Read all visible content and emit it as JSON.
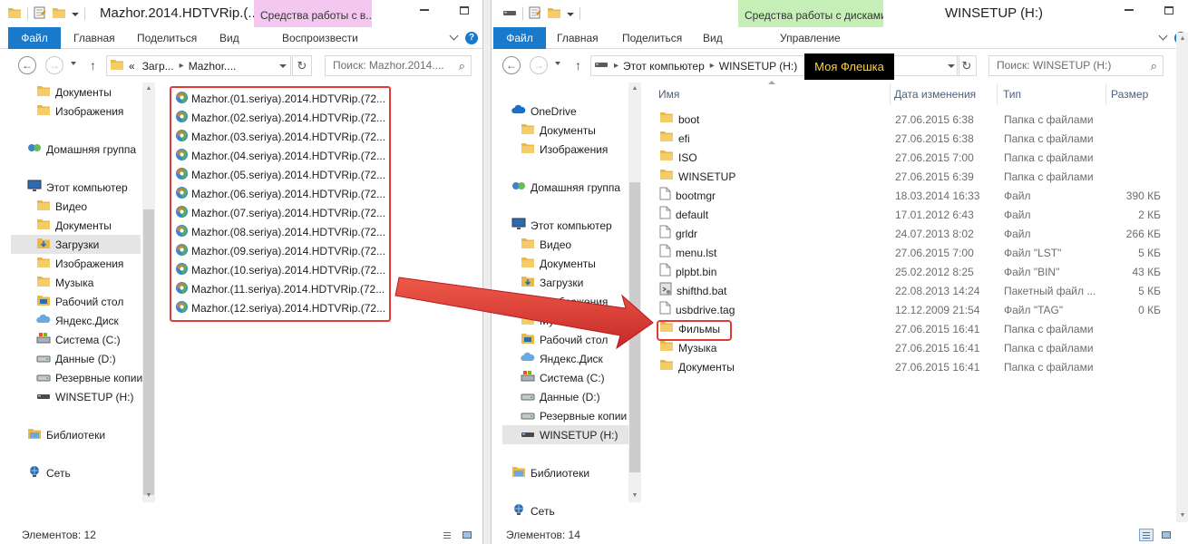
{
  "left": {
    "title": "Mazhor.2014.HDTVRip.(...",
    "tools_tab": "Средства работы с в...",
    "tools_color": "#f4c7f1",
    "ribbon": [
      "Файл",
      "Главная",
      "Поделиться",
      "Вид",
      "Воспроизвести"
    ],
    "address": {
      "overflow": "«",
      "segments": [
        "Загр...",
        "Mazhor...."
      ]
    },
    "search_placeholder": "Поиск: Mazhor.2014....",
    "nav": [
      {
        "label": "Документы",
        "icon": "documents-folder-icon"
      },
      {
        "label": "Изображения",
        "icon": "pictures-folder-icon"
      },
      {
        "label": "Домашняя группа",
        "icon": "homegroup-icon"
      },
      {
        "label": "Этот компьютер",
        "icon": "computer-icon"
      },
      {
        "label": "Видео",
        "icon": "videos-folder-icon"
      },
      {
        "label": "Документы",
        "icon": "documents-folder-icon"
      },
      {
        "label": "Загрузки",
        "icon": "downloads-folder-icon"
      },
      {
        "label": "Изображения",
        "icon": "pictures-folder-icon"
      },
      {
        "label": "Музыка",
        "icon": "music-folder-icon"
      },
      {
        "label": "Рабочий стол",
        "icon": "desktop-folder-icon"
      },
      {
        "label": "Яндекс.Диск",
        "icon": "yandex-disk-icon"
      },
      {
        "label": "Система (C:)",
        "icon": "system-drive-icon"
      },
      {
        "label": "Данные (D:)",
        "icon": "drive-icon"
      },
      {
        "label": "Резервные копии",
        "icon": "drive-icon"
      },
      {
        "label": "WINSETUP (H:)",
        "icon": "usb-drive-icon"
      },
      {
        "label": "Библиотеки",
        "icon": "libraries-icon"
      },
      {
        "label": "Сеть",
        "icon": "network-icon"
      }
    ],
    "files": [
      "Mazhor.(01.seriya).2014.HDTVRip.(72...",
      "Mazhor.(02.seriya).2014.HDTVRip.(72...",
      "Mazhor.(03.seriya).2014.HDTVRip.(72...",
      "Mazhor.(04.seriya).2014.HDTVRip.(72...",
      "Mazhor.(05.seriya).2014.HDTVRip.(72...",
      "Mazhor.(06.seriya).2014.HDTVRip.(72...",
      "Mazhor.(07.seriya).2014.HDTVRip.(72...",
      "Mazhor.(08.seriya).2014.HDTVRip.(72...",
      "Mazhor.(09.seriya).2014.HDTVRip.(72...",
      "Mazhor.(10.seriya).2014.HDTVRip.(72...",
      "Mazhor.(11.seriya).2014.HDTVRip.(72...",
      "Mazhor.(12.seriya).2014.HDTVRip.(72..."
    ],
    "status": "Элементов: 12"
  },
  "right": {
    "title": "WINSETUP (H:)",
    "tools_tab": "Средства работы с дисками",
    "tools_color": "#c6efb8",
    "ribbon": [
      "Файл",
      "Главная",
      "Поделиться",
      "Вид",
      "Управление"
    ],
    "address": {
      "segments": [
        "Этот компьютер",
        "WINSETUP (H:)"
      ]
    },
    "tooltip": "Моя Флешка",
    "search_placeholder": "Поиск: WINSETUP (H:)",
    "nav": [
      {
        "label": "OneDrive",
        "icon": "onedrive-icon"
      },
      {
        "label": "Документы",
        "icon": "documents-folder-icon"
      },
      {
        "label": "Изображения",
        "icon": "pictures-folder-icon"
      },
      {
        "label": "Домашняя группа",
        "icon": "homegroup-icon"
      },
      {
        "label": "Этот компьютер",
        "icon": "computer-icon"
      },
      {
        "label": "Видео",
        "icon": "videos-folder-icon"
      },
      {
        "label": "Документы",
        "icon": "documents-folder-icon"
      },
      {
        "label": "Загрузки",
        "icon": "downloads-folder-icon"
      },
      {
        "label": "Изображения",
        "icon": "pictures-folder-icon"
      },
      {
        "label": "Музыка",
        "icon": "music-folder-icon"
      },
      {
        "label": "Рабочий стол",
        "icon": "desktop-folder-icon"
      },
      {
        "label": "Яндекс.Диск",
        "icon": "yandex-disk-icon"
      },
      {
        "label": "Система (C:)",
        "icon": "system-drive-icon"
      },
      {
        "label": "Данные (D:)",
        "icon": "drive-icon"
      },
      {
        "label": "Резервные копии",
        "icon": "drive-icon"
      },
      {
        "label": "WINSETUP (H:)",
        "icon": "usb-drive-icon"
      },
      {
        "label": "Библиотеки",
        "icon": "libraries-icon"
      },
      {
        "label": "Сеть",
        "icon": "network-icon"
      }
    ],
    "columns": [
      "Имя",
      "Дата изменения",
      "Тип",
      "Размер"
    ],
    "rows": [
      {
        "name": "boot",
        "date": "27.06.2015 6:38",
        "type": "Папка с файлами",
        "size": "",
        "icon": "folder-icon"
      },
      {
        "name": "efi",
        "date": "27.06.2015 6:38",
        "type": "Папка с файлами",
        "size": "",
        "icon": "folder-icon"
      },
      {
        "name": "ISO",
        "date": "27.06.2015 7:00",
        "type": "Папка с файлами",
        "size": "",
        "icon": "folder-icon"
      },
      {
        "name": "WINSETUP",
        "date": "27.06.2015 6:39",
        "type": "Папка с файлами",
        "size": "",
        "icon": "folder-icon"
      },
      {
        "name": "bootmgr",
        "date": "18.03.2014 16:33",
        "type": "Файл",
        "size": "390 КБ",
        "icon": "file-icon"
      },
      {
        "name": "default",
        "date": "17.01.2012 6:43",
        "type": "Файл",
        "size": "2 КБ",
        "icon": "file-icon"
      },
      {
        "name": "grldr",
        "date": "24.07.2013 8:02",
        "type": "Файл",
        "size": "266 КБ",
        "icon": "file-icon"
      },
      {
        "name": "menu.lst",
        "date": "27.06.2015 7:00",
        "type": "Файл \"LST\"",
        "size": "5 КБ",
        "icon": "file-icon"
      },
      {
        "name": "plpbt.bin",
        "date": "25.02.2012 8:25",
        "type": "Файл \"BIN\"",
        "size": "43 КБ",
        "icon": "file-icon"
      },
      {
        "name": "shifthd.bat",
        "date": "22.08.2013 14:24",
        "type": "Пакетный файл ...",
        "size": "5 КБ",
        "icon": "batch-file-icon"
      },
      {
        "name": "usbdrive.tag",
        "date": "12.12.2009 21:54",
        "type": "Файл \"TAG\"",
        "size": "0 КБ",
        "icon": "file-icon"
      },
      {
        "name": "Фильмы",
        "date": "27.06.2015 16:41",
        "type": "Папка с файлами",
        "size": "",
        "icon": "folder-icon"
      },
      {
        "name": "Музыка",
        "date": "27.06.2015 16:41",
        "type": "Папка с файлами",
        "size": "",
        "icon": "folder-icon"
      },
      {
        "name": "Документы",
        "date": "27.06.2015 16:41",
        "type": "Папка с файлами",
        "size": "",
        "icon": "folder-icon"
      }
    ],
    "status": "Элементов: 14"
  },
  "colors": {
    "accent": "#1979ca",
    "highlight": "#e53935",
    "tooltip_text": "#ffd33a",
    "folder": "#e8b84a"
  }
}
